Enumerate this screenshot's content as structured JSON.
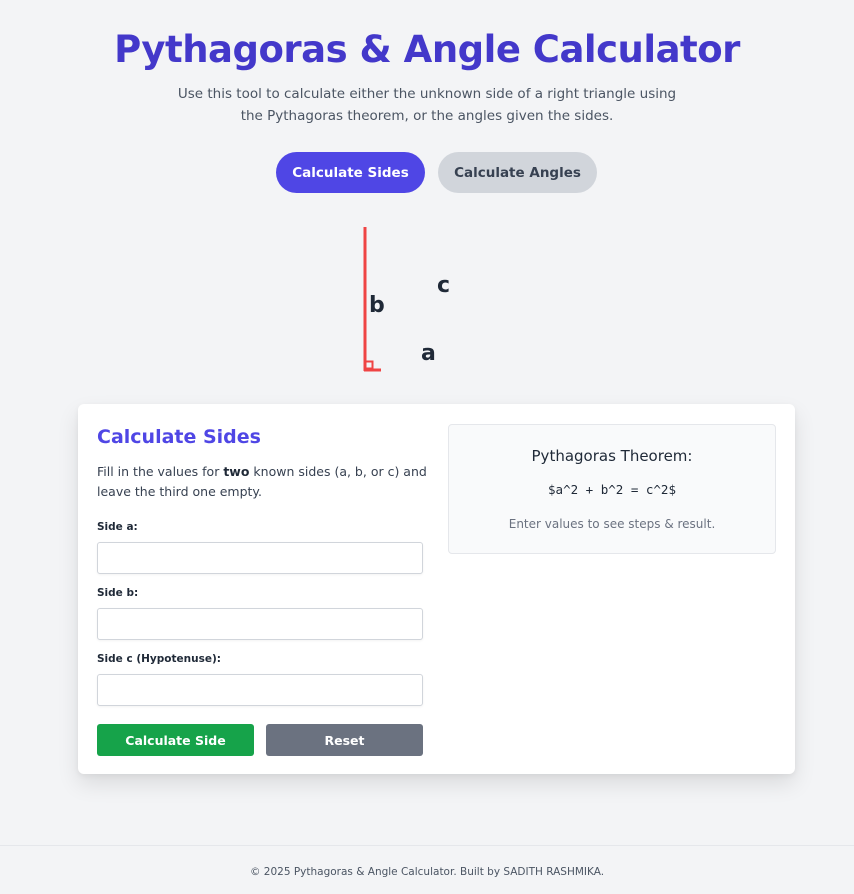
{
  "header": {
    "title": "Pythagoras & Angle Calculator",
    "subtitle": "Use this tool to calculate either the unknown side of a right triangle using the Pythagoras theorem, or the angles given the sides."
  },
  "mode_tabs": {
    "sides_label": "Calculate Sides",
    "angles_label": "Calculate Angles",
    "active": "sides"
  },
  "triangle": {
    "label_a": "a",
    "label_b": "b",
    "label_c": "c",
    "line_color": "#ef4444"
  },
  "form": {
    "title": "Calculate Sides",
    "desc_prefix": "Fill in the values for ",
    "desc_bold": "two",
    "desc_suffix": " known sides (a, b, or c) and leave the third one empty.",
    "side_a_label": "Side a:",
    "side_b_label": "Side b:",
    "side_c_label": "Side c (Hypotenuse):",
    "side_a_value": "",
    "side_b_value": "",
    "side_c_value": "",
    "calculate_label": "Calculate Side",
    "reset_label": "Reset"
  },
  "theorem": {
    "title": "Pythagoras Theorem:",
    "formula": "$a^2 + b^2 = c^2$",
    "hint": "Enter values to see steps & result."
  },
  "footer": {
    "text": "© 2025 Pythagoras & Angle Calculator. Built by SADITH RASHMIKA."
  },
  "colors": {
    "accent": "#4f46e5",
    "title": "#4338ca",
    "success": "#16a34a",
    "neutral": "#6b7280"
  }
}
